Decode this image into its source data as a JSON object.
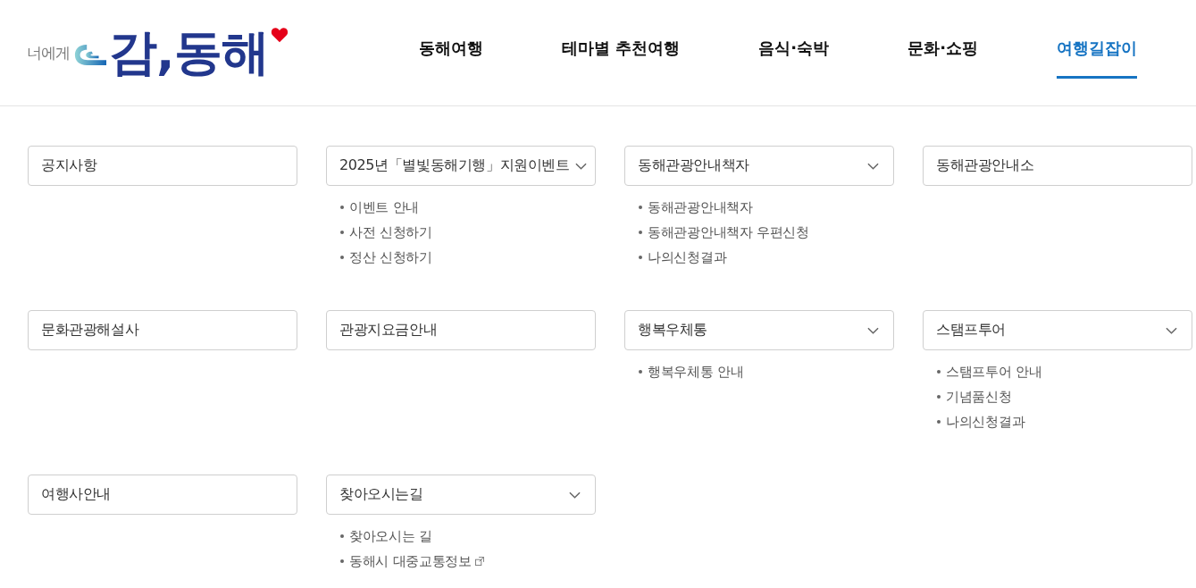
{
  "logo": {
    "tagline": "너에게",
    "wordmark": "감,동해"
  },
  "nav": [
    {
      "label": "동해여행",
      "selected": false
    },
    {
      "label": "테마별 추천여행",
      "selected": false
    },
    {
      "label": "음식·숙박",
      "selected": false
    },
    {
      "label": "문화·쇼핑",
      "selected": false
    },
    {
      "label": "여행길잡이",
      "selected": true
    }
  ],
  "menu": [
    {
      "title": "공지사항",
      "kind": "link"
    },
    {
      "title": "2025년「별빛동해기행」지원이벤트",
      "kind": "dropdown",
      "items": [
        {
          "label": "이벤트 안내",
          "external": false
        },
        {
          "label": "사전 신청하기",
          "external": false
        },
        {
          "label": "정산 신청하기",
          "external": false
        }
      ]
    },
    {
      "title": "동해관광안내책자",
      "kind": "dropdown",
      "items": [
        {
          "label": "동해관광안내책자",
          "external": false
        },
        {
          "label": "동해관광안내책자 우편신청",
          "external": false
        },
        {
          "label": "나의신청결과",
          "external": false
        }
      ]
    },
    {
      "title": "동해관광안내소",
      "kind": "link"
    },
    {
      "title": "문화관광해설사",
      "kind": "link"
    },
    {
      "title": "관광지요금안내",
      "kind": "link"
    },
    {
      "title": "행복우체통",
      "kind": "dropdown",
      "items": [
        {
          "label": "행복우체통 안내",
          "external": false
        }
      ]
    },
    {
      "title": "스탬프투어",
      "kind": "dropdown",
      "items": [
        {
          "label": "스탬프투어 안내",
          "external": false
        },
        {
          "label": "기념품신청",
          "external": false
        },
        {
          "label": "나의신청결과",
          "external": false
        }
      ]
    },
    {
      "title": "여행사안내",
      "kind": "link"
    },
    {
      "title": "찾아오시는길",
      "kind": "dropdown",
      "items": [
        {
          "label": "찾아오시는 길",
          "external": false
        },
        {
          "label": "동해시 대중교통정보",
          "external": true
        }
      ]
    }
  ]
}
